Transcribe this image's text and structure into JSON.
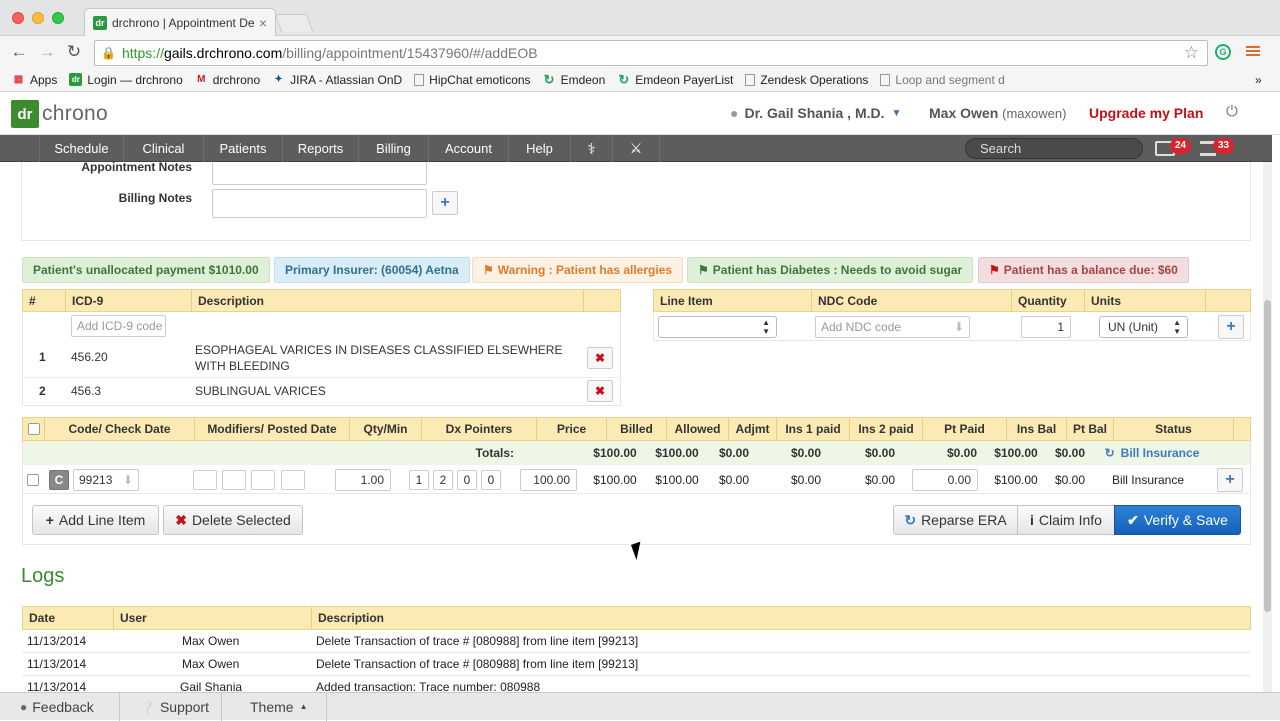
{
  "browser": {
    "tab_title": "drchrono | Appointment De",
    "tab_close": "×",
    "url_https": "https://",
    "url_host": "gails.drchrono.com",
    "url_path": "/billing/appointment/15437960/#/addEOB",
    "bookmarks": [
      {
        "label": "Apps",
        "icon": "apps-grid-icon"
      },
      {
        "label": "Login — drchrono",
        "icon": "drchrono-favicon"
      },
      {
        "label": "drchrono",
        "icon": "gmail-icon"
      },
      {
        "label": "JIRA - Atlassian OnD",
        "icon": "jira-icon"
      },
      {
        "label": "HipChat emoticons",
        "icon": "page-icon"
      },
      {
        "label": "Emdeon",
        "icon": "emdeon-icon"
      },
      {
        "label": "Emdeon PayerList",
        "icon": "emdeon-icon"
      },
      {
        "label": "Zendesk Operations",
        "icon": "page-icon"
      },
      {
        "label": "Loop and segment d",
        "icon": "page-icon"
      }
    ],
    "more": "»"
  },
  "header": {
    "logo_dr": "dr",
    "logo_text": "chrono",
    "doctor": "Dr. Gail Shania , M.D.",
    "user": "Max Owen",
    "username": "(maxowen)",
    "upgrade": "Upgrade my Plan"
  },
  "nav": {
    "items": [
      "Schedule",
      "Clinical",
      "Patients",
      "Reports",
      "Billing",
      "Account",
      "Help"
    ],
    "search_placeholder": "Search",
    "messages_count": "24",
    "tasks_count": "33"
  },
  "form": {
    "appointment_notes_label": "Appointment Notes",
    "billing_notes_label": "Billing Notes"
  },
  "alerts": [
    {
      "text": "Patient's unallocated payment $1010.00",
      "bg": "#dff0d8",
      "fg": "#3c763d"
    },
    {
      "text": "Primary Insurer: (60054) Aetna",
      "bg": "#d9edf7",
      "fg": "#31708f"
    },
    {
      "text": "Warning : Patient has allergies",
      "bg": "#fcf8e3",
      "fg": "#e07b2a",
      "icon": "flag-icon"
    },
    {
      "text": "Patient has Diabetes : Needs to avoid sugar",
      "bg": "#dff0d8",
      "fg": "#3c763d",
      "icon": "flag-icon"
    },
    {
      "text": "Patient has a balance due: $60",
      "bg": "#f2dede",
      "fg": "#a94442",
      "icon": "flag-icon"
    }
  ],
  "icd": {
    "headers": [
      "#",
      "ICD-9",
      "Description"
    ],
    "add_placeholder": "Add ICD-9 code",
    "rows": [
      {
        "num": "1",
        "code": "456.20",
        "desc1": "ESOPHAGEAL VARICES IN DISEASES CLASSIFIED ELSEWHERE",
        "desc2": "WITH BLEEDING"
      },
      {
        "num": "2",
        "code": "456.3",
        "desc1": "SUBLINGUAL VARICES",
        "desc2": ""
      }
    ]
  },
  "line_item": {
    "headers": [
      "Line Item",
      "NDC Code",
      "Quantity",
      "Units"
    ],
    "ndc_placeholder": "Add NDC code",
    "quantity": "1",
    "units": "UN (Unit)"
  },
  "billing": {
    "headers": [
      "Code/ Check Date",
      "Modifiers/ Posted Date",
      "Qty/Min",
      "Dx Pointers",
      "Price",
      "Billed",
      "Allowed",
      "Adjmt",
      "Ins 1 paid",
      "Ins 2 paid",
      "Pt Paid",
      "Ins Bal",
      "Pt Bal",
      "Status"
    ],
    "totals_label": "Totals:",
    "totals": [
      "$100.00",
      "$100.00",
      "$0.00",
      "$0.00",
      "$0.00",
      "$0.00",
      "$100.00",
      "$0.00"
    ],
    "totals_status": "Bill Insurance",
    "row": {
      "c_badge": "C",
      "code": "99213",
      "qty": "1.00",
      "dx": [
        "1",
        "2",
        "0",
        "0"
      ],
      "price": "100.00",
      "billed": "$100.00",
      "allowed": "$100.00",
      "adjmt": "$0.00",
      "ins1": "$0.00",
      "ins2": "$0.00",
      "pt_paid": "0.00",
      "ins_bal": "$100.00",
      "pt_bal": "$0.00",
      "status": "Bill Insurance"
    }
  },
  "actions": {
    "add_line": "Add Line Item",
    "delete_selected": "Delete Selected",
    "reparse": "Reparse ERA",
    "claim_info": "Claim Info",
    "verify_save": "Verify & Save"
  },
  "logs": {
    "title": "Logs",
    "headers": [
      "Date",
      "User",
      "Description"
    ],
    "rows": [
      {
        "date": "11/13/2014",
        "user": "Max Owen",
        "desc": "Delete Transaction of trace # [080988] from line item [99213]"
      },
      {
        "date": "11/13/2014",
        "user": "Max Owen",
        "desc": "Delete Transaction of trace # [080988] from line item [99213]"
      },
      {
        "date": "11/13/2014",
        "user": "Gail Shania",
        "desc": "Added transaction: Trace number: 080988"
      }
    ]
  },
  "footer": {
    "feedback": "Feedback",
    "support": "Support",
    "theme": "Theme"
  }
}
